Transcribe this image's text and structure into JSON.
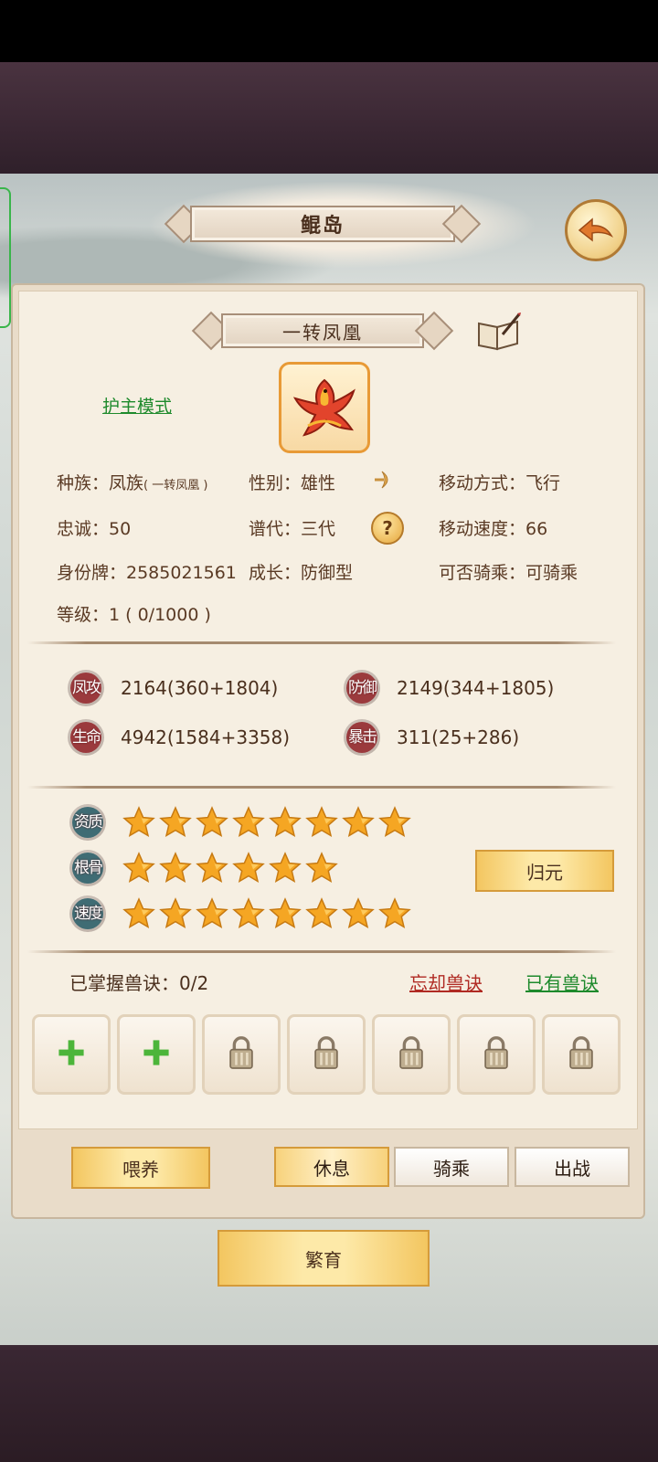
{
  "header": {
    "title": "鲲岛"
  },
  "pet": {
    "name": "一转凤凰",
    "guard_mode": "护主模式",
    "race_label": "种族：凤族",
    "race_sub": "( 一转凤凰 )",
    "gender": "性别：雄性",
    "move_mode": "移动方式：飞行",
    "loyalty": "忠诚：50",
    "generation": "谱代：三代",
    "move_speed": "移动速度：66",
    "id_tag": "身份牌：2585021561",
    "growth": "成长：防御型",
    "rideable": "可否骑乘：可骑乘",
    "level": "等级：1 ( 0/1000 )"
  },
  "stats": [
    {
      "label": "凤攻",
      "value": "2164(360+1804)"
    },
    {
      "label": "防御",
      "value": "2149(344+1805)"
    },
    {
      "label": "生命",
      "value": "4942(1584+3358)"
    },
    {
      "label": "暴击",
      "value": "311(25+286)"
    }
  ],
  "aptitudes": [
    {
      "label": "资质",
      "stars": 8
    },
    {
      "label": "根骨",
      "stars": 6
    },
    {
      "label": "速度",
      "stars": 8
    }
  ],
  "actions": {
    "return_origin": "归元",
    "mastered": "已掌握兽诀：0/2",
    "forget": "忘却兽诀",
    "owned": "已有兽诀",
    "feed": "喂养",
    "rest": "休息",
    "ride": "骑乘",
    "battle": "出战",
    "breed": "繁育"
  },
  "skill_slots": [
    "add",
    "add",
    "locked",
    "locked",
    "locked",
    "locked",
    "locked"
  ],
  "colors": {
    "accent_gold": "#f3c660",
    "link_green": "#1e8a2c",
    "link_red": "#b02a23",
    "badge_red": "#9b3a3d"
  }
}
